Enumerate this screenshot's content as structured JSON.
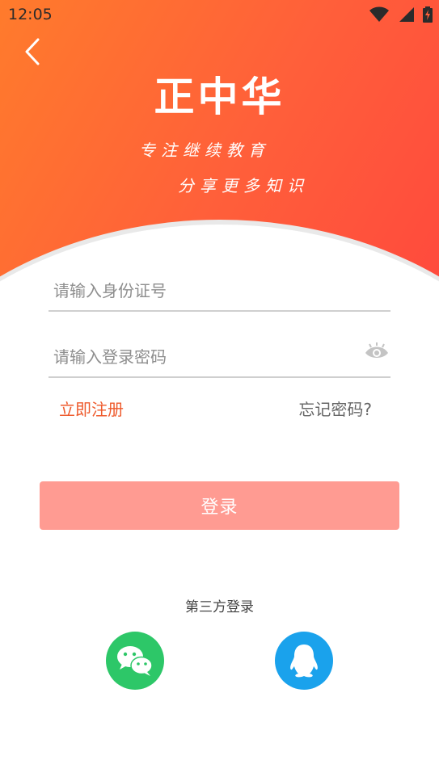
{
  "status_bar": {
    "time": "12:05"
  },
  "header": {
    "brand": "正中华",
    "slogan_line1": "专注继续教育",
    "slogan_line2": "分享更多知识"
  },
  "form": {
    "id_placeholder": "请输入身份证号",
    "password_placeholder": "请输入登录密码",
    "register_label": "立即注册",
    "forgot_label": "忘记密码?",
    "login_label": "登录"
  },
  "third_party": {
    "title": "第三方登录",
    "providers": [
      "wechat-icon",
      "qq-icon"
    ]
  },
  "colors": {
    "header_start": "#ff7b2c",
    "header_end": "#ff4a3d",
    "accent": "#ee5a2c",
    "login_button": "#ff9b92",
    "wechat": "#2dc768",
    "qq": "#1aa2ec"
  }
}
